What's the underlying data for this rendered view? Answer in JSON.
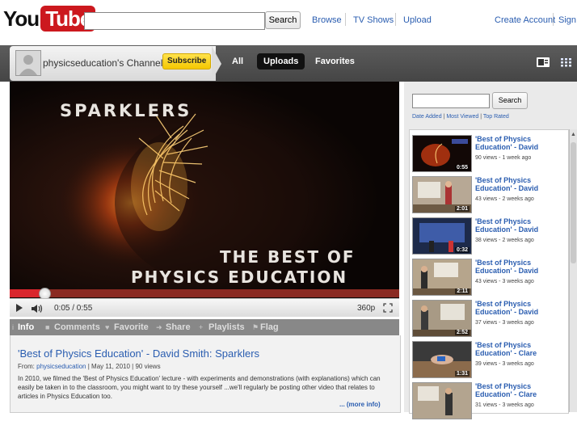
{
  "header": {
    "logo_you": "You",
    "logo_tube": "Tube",
    "search_value": "",
    "search_button": "Search",
    "nav": [
      "Browse",
      "TV Shows",
      "Upload"
    ],
    "account": [
      "Create Account",
      "Sign"
    ]
  },
  "channel": {
    "name": "physicseducation's Channel",
    "subscribe": "Subscribe",
    "tabs": [
      "All",
      "Uploads",
      "Favorites"
    ]
  },
  "video": {
    "overlay_line1": "SPARKLERS",
    "overlay_line2": "THE BEST OF",
    "overlay_line3": "PHYSICS EDUCATION",
    "time": "0:05 / 0:55",
    "quality": "360p",
    "progress": 0.09
  },
  "tabs": [
    "Info",
    "Comments",
    "Favorite",
    "Share",
    "Playlists",
    "Flag"
  ],
  "info": {
    "title": "'Best of Physics Education' - David Smith: Sparklers",
    "from_label": "From:",
    "from_user": "physicseducation",
    "meta": "| May 11, 2010 | 90 views",
    "description": "In 2010, we filmed the 'Best of Physics Education' lecture - with experiments and demonstrations (with explanations) which can easily be taken in to the classroom, you might want to try these yourself ...we'll regularly be posting other video that relates to articles in Physics Education too.",
    "more": "... (more info)"
  },
  "sidebar": {
    "search_value": "",
    "search_button": "Search",
    "sort": [
      "Date Added",
      "Most Viewed",
      "Top Rated"
    ],
    "videos": [
      {
        "title": "'Best of Physics Education' - David",
        "meta": "90 views - 1 week ago",
        "duration": "0:55"
      },
      {
        "title": "'Best of Physics Education' - David",
        "meta": "43 views - 2 weeks ago",
        "duration": "2:01"
      },
      {
        "title": "'Best of Physics Education' - David",
        "meta": "38 views - 2 weeks ago",
        "duration": "0:32"
      },
      {
        "title": "'Best of Physics Education' - David",
        "meta": "43 views - 3 weeks ago",
        "duration": "2:11"
      },
      {
        "title": "'Best of Physics Education' - David",
        "meta": "37 views - 3 weeks ago",
        "duration": "2:52"
      },
      {
        "title": "'Best of Physics Education' - Clare",
        "meta": "39 views - 3 weeks ago",
        "duration": "1:31"
      },
      {
        "title": "'Best of Physics Education' - Clare",
        "meta": "31 views - 3 weeks ago",
        "duration": ""
      }
    ]
  },
  "colors": {
    "link": "#2a5db0",
    "brand_red": "#cc181e",
    "subscribe_yellow": "#f5c800",
    "progress_red": "#d9262d"
  }
}
